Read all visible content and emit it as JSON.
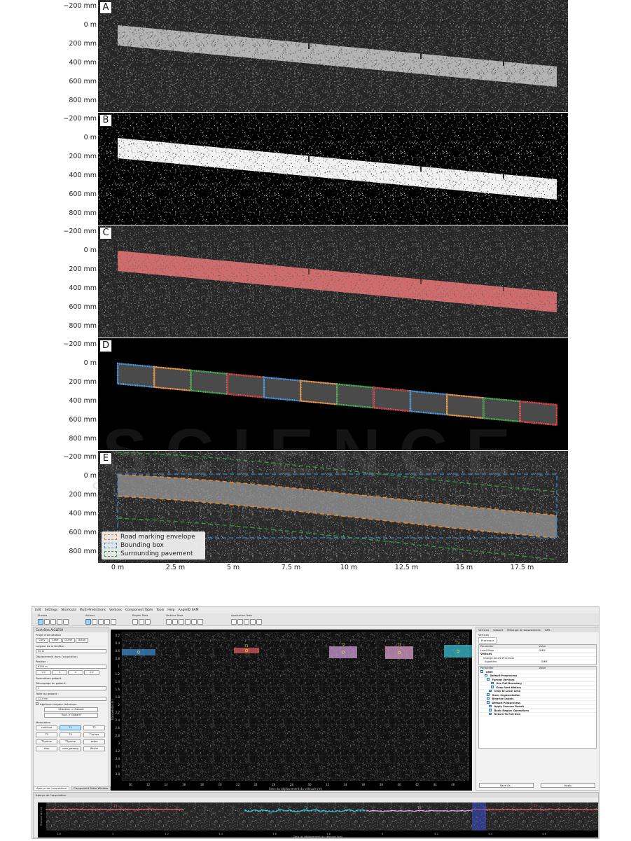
{
  "figure": {
    "panel_labels": [
      "A",
      "B",
      "C",
      "D",
      "E"
    ],
    "y_ticks": [
      "−200 mm",
      "0 m",
      "200 mm",
      "400 mm",
      "600 mm",
      "800 mm"
    ],
    "x_ticks": [
      "0 m",
      "2.5 m",
      "5 m",
      "7.5 m",
      "10 m",
      "12.5 m",
      "15 m",
      "17.5 m"
    ],
    "legend": [
      {
        "label": "Road marking envelope",
        "color": "#e8892c"
      },
      {
        "label": "Bounding box",
        "color": "#2f86d4"
      },
      {
        "label": "Surrounding pavement",
        "color": "#2e9d3a"
      }
    ],
    "segment_colors": [
      "#2f86d4",
      "#e8892c",
      "#2e9d3a",
      "#d42c2c"
    ],
    "mask_color": "#e05a5a"
  },
  "watermark": {
    "line1": "SCIENCE",
    "line2": "SCIENCE AND TECHNOLOGY PUBLICATIONS"
  },
  "app": {
    "menu": [
      "Edit",
      "Settings",
      "Shortcuts",
      "Multi-Predictions",
      "Vertices",
      "Component Table",
      "Tools",
      "Help",
      "AngleID SAM"
    ],
    "toolbar_groups": [
      "Shapes",
      "Actions",
      "Region Tools",
      "Vertices Tools",
      "Application Tools"
    ],
    "left_dock": {
      "title": "Contrôles AIGLESH",
      "annotation_project": "Projet d'annotation",
      "buttons_row1": [
        "Conv",
        "Créer",
        "Ouvrir",
        "Actua"
      ],
      "window_width_label": "Largeur de la fenêtre :",
      "window_width_value": "30 m",
      "displacement_label": "Déplacement dans l'acquisition",
      "position_label": "Position :",
      "position_value": "6255 m",
      "nav_buttons": [
        "<<",
        "<",
        ">",
        ">>"
      ],
      "template_params": "Paramètres gabarit",
      "template_cut_label": "Découpage du gabarit :",
      "template_cut_value": "1",
      "template_size_label": "Taille du gabarit :",
      "template_size_value": "12.0 cm",
      "theoretical_width": "Appliquer largeur théorique",
      "selection_button": "Sélection -> Gabarit",
      "all_button": "Tout -> Gabarit",
      "modulation_label": "Modulation",
      "modulation_buttons": [
        "continue",
        "T1",
        "T2",
        "T3",
        "T4",
        "T'prime",
        "T2prime",
        "T3prime",
        "zebra",
        "stop",
        "cder_passag",
        "fleche"
      ],
      "selected_modulation": "T1"
    },
    "main_view": {
      "y_axis_label": "Transverse (m)",
      "x_axis_label": "Sens du déplacement du véhicule (m)",
      "x_ticks": [
        "10",
        "12",
        "14",
        "16",
        "18",
        "20",
        "22",
        "24",
        "26",
        "28",
        "30",
        "32",
        "34",
        "36",
        "38",
        "40",
        "42",
        "44",
        "46"
      ],
      "y_ticks": [
        "0.2",
        "0.4",
        "0.6",
        "0.8",
        "1",
        "1.2",
        "1.4",
        "1.6",
        "1.8",
        "2",
        "2.2",
        "2.4",
        "2.6",
        "2.8",
        "3",
        "3.2",
        "3.4",
        "3.6",
        "3.8"
      ],
      "markers": [
        {
          "label": "",
          "color": "#3a8fd0"
        },
        {
          "label": "T1",
          "color": "#e06060"
        },
        {
          "label": "T2",
          "color": "#d7a3e0"
        },
        {
          "label": "T3",
          "color": "#e8a8d8"
        },
        {
          "label": "T4",
          "color": "#38c8d8"
        }
      ]
    },
    "right_dock": {
      "tabs": [
        "Vertices",
        "Gabarit",
        "Mélange de Gaussiennes",
        "GPS"
      ],
      "sub_title": "Vertices",
      "inner_tab": "Processor",
      "table1_header": [
        "Parameter",
        "Value"
      ],
      "table1_rows": [
        [
          "Load State",
          "GMM"
        ],
        [
          "Vertices",
          ""
        ],
        [
          "Change Active Processor",
          ""
        ],
        [
          "Algorithm",
          "GMM"
        ]
      ],
      "table2_header": [
        "Parameter",
        "Value"
      ],
      "tree": [
        "GMM",
        "Default Preprocess",
        "Format Vertices",
        "Use Full Boundary",
        "Keep Vert History",
        "Crop To Local Area",
        "Gmm Segmentation",
        "Binarize Labels",
        "Default Postprocess",
        "Apply Process Result",
        "Basic Region Operations",
        "Return To Full Size"
      ],
      "save_button": "Save As...",
      "apply_button": "Apply"
    },
    "bottom_dock": {
      "title": "Aperçu de l'acquisition",
      "tabs": [
        "Aperçu de l'acquisition",
        "Component Table Window"
      ],
      "x_axis_label": "Sens du déplacement du véhicule (km)",
      "y_axis_label": "Transverse (m)",
      "x_ticks": [
        "2.8",
        "3",
        "3.2",
        "3.4",
        "3.6",
        "3.8",
        "4",
        "4.2",
        "4.4",
        "4.6"
      ],
      "track_labels": [
        "T1",
        "T2",
        "T3",
        "T1"
      ],
      "track_colors": [
        "#f06070",
        "#40c8e0",
        "#e8a8e8",
        "#f06070"
      ]
    }
  }
}
